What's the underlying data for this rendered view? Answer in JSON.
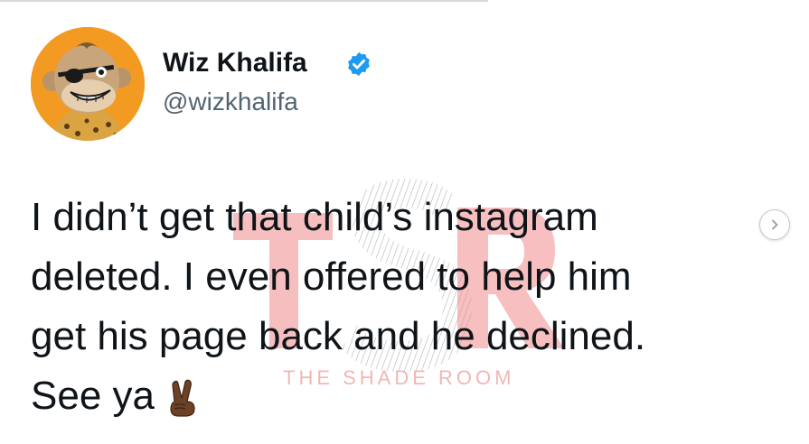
{
  "tweet": {
    "author": {
      "display_name": "Wiz Khalifa",
      "handle": "@wizkhalifa",
      "verified": true,
      "avatar_icon": "bored-ape-avatar"
    },
    "text_lines": [
      "I didn’t get that child’s instagram",
      "deleted. I even offered to help him",
      "get his page back and he declined.",
      "See ya"
    ],
    "emoji": "victory-hand-emoji"
  },
  "watermark": {
    "text": "THE SHADE ROOM",
    "logo": "TSR",
    "color": "#f0a0a0"
  },
  "navigation": {
    "next_icon": "chevron-right-icon"
  },
  "colors": {
    "verified_blue": "#1d9bf0",
    "avatar_bg": "#f39a23",
    "handle_gray": "#536471"
  }
}
